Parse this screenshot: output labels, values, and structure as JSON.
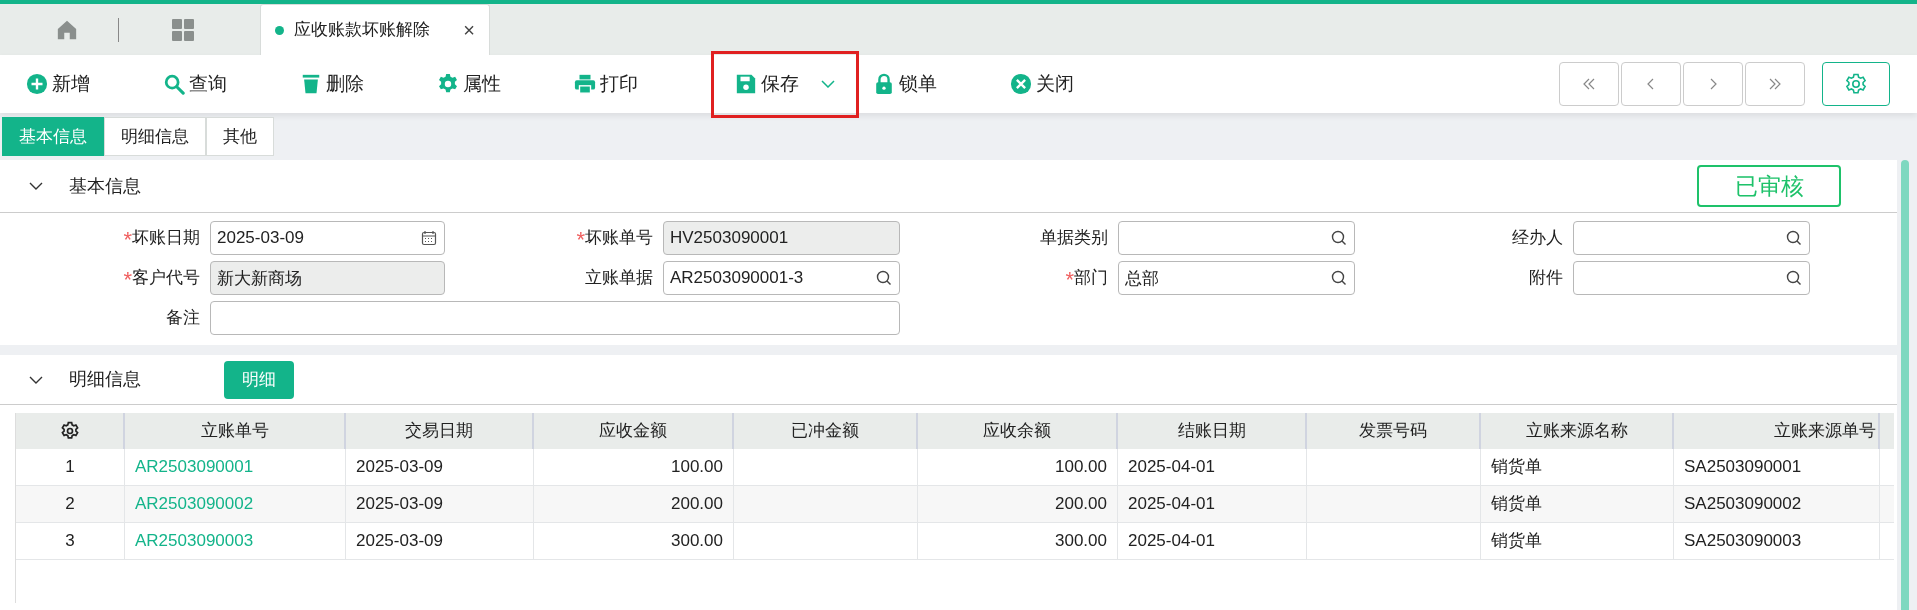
{
  "tabs": [
    {
      "label": "应收账款坏账解除",
      "selected": true,
      "close": "×"
    }
  ],
  "toolbar": [
    {
      "kind": "add",
      "label": "新增"
    },
    {
      "kind": "search",
      "label": "查询"
    },
    {
      "kind": "delete",
      "label": "删除"
    },
    {
      "kind": "settings",
      "label": "属性"
    },
    {
      "kind": "print",
      "label": "打印"
    },
    {
      "kind": "save",
      "label": "保存",
      "highlighted": true
    },
    {
      "kind": "lock",
      "label": "锁单"
    },
    {
      "kind": "close",
      "label": "关闭"
    }
  ],
  "sub_tabs": [
    {
      "label": "基本信息",
      "selected": true
    },
    {
      "label": "明细信息",
      "selected": false
    },
    {
      "label": "其他",
      "selected": false
    }
  ],
  "basic_section": {
    "title": "基本信息",
    "expanded": true,
    "status_badge": "已审核",
    "fields": [
      {
        "label": "坏账日期",
        "required_mark": "*",
        "kind": "date",
        "value": "2025-03-09"
      },
      {
        "label": "坏账单号",
        "required_mark": "*",
        "kind": "readonly",
        "value": "HV2503090001"
      },
      {
        "label": "单据类别",
        "kind": "lookup"
      },
      {
        "label": "经办人",
        "kind": "lookup"
      },
      {
        "label": "客户代号",
        "required_mark": "*",
        "kind": "readonly",
        "value": "新大新商场"
      },
      {
        "label": "立账单据",
        "kind": "lookup",
        "value": "AR2503090001-3"
      },
      {
        "label": "部门",
        "required_mark": "*",
        "kind": "lookup",
        "value": "总部"
      },
      {
        "label": "附件",
        "kind": "lookup"
      },
      {
        "label": "备注",
        "kind": "note"
      }
    ]
  },
  "detail_section": {
    "title": "明细信息",
    "expanded": true,
    "button": "明细",
    "table": {
      "columns": [
        {
          "label": "立账单号",
          "kind": "link"
        },
        {
          "label": "交易日期",
          "kind": "text"
        },
        {
          "label": "应收金额",
          "kind": "number"
        },
        {
          "label": "已冲金额",
          "kind": "number"
        },
        {
          "label": "应收余额",
          "kind": "number"
        },
        {
          "label": "结账日期",
          "kind": "text"
        },
        {
          "label": "发票号码",
          "kind": "text"
        },
        {
          "label": "立账来源名称",
          "kind": "text"
        },
        {
          "label": "立账来源单号",
          "kind": "text"
        }
      ],
      "rows": [
        {
          "index": "1",
          "cells": [
            "AR2503090001",
            "2025-03-09",
            "100.00",
            null,
            "100.00",
            "2025-04-01",
            null,
            "销货单",
            "SA2503090001"
          ]
        },
        {
          "index": "2",
          "cells": [
            "AR2503090002",
            "2025-03-09",
            "200.00",
            null,
            "200.00",
            "2025-04-01",
            null,
            "销货单",
            "SA2503090002"
          ]
        },
        {
          "index": "3",
          "cells": [
            "AR2503090003",
            "2025-03-09",
            "300.00",
            null,
            "300.00",
            "2025-04-01",
            null,
            "销货单",
            "SA2503090003"
          ]
        }
      ]
    }
  }
}
